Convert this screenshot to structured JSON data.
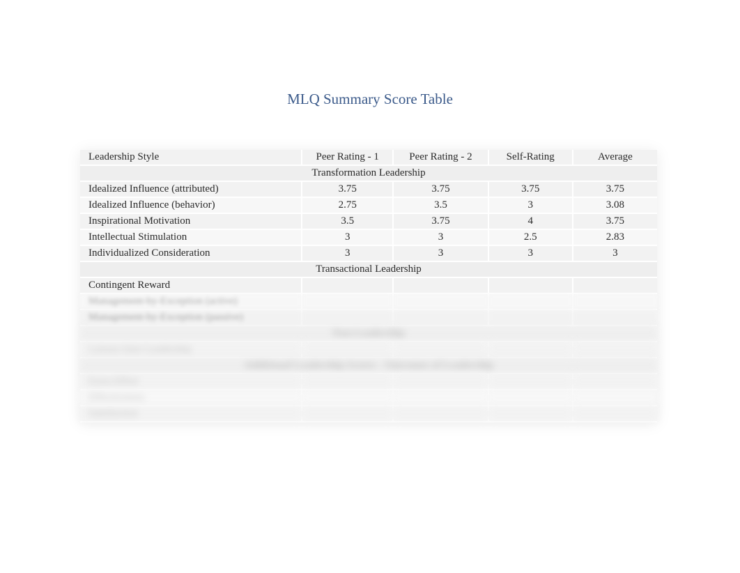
{
  "title": "MLQ Summary Score Table",
  "headers": {
    "style": "Leadership Style",
    "peer1": "Peer Rating - 1",
    "peer2": "Peer Rating - 2",
    "self": "Self-Rating",
    "avg": "Average"
  },
  "sections": {
    "s1": "Transformation Leadership",
    "s2": "Transactional Leadership",
    "s3": "Non-Leadership",
    "s4": "Additional Leadership Scores - Outcomes of Leadership"
  },
  "rows": {
    "r1": {
      "label": "Idealized Influence (attributed)",
      "p1": "3.75",
      "p2": "3.75",
      "self": "3.75",
      "avg": "3.75"
    },
    "r2": {
      "label": "Idealized Influence (behavior)",
      "p1": "2.75",
      "p2": "3.5",
      "self": "3",
      "avg": "3.08"
    },
    "r3": {
      "label": "Inspirational Motivation",
      "p1": "3.5",
      "p2": "3.75",
      "self": "4",
      "avg": "3.75"
    },
    "r4": {
      "label": "Intellectual Stimulation",
      "p1": "3",
      "p2": "3",
      "self": "2.5",
      "avg": "2.83"
    },
    "r5": {
      "label": "Individualized Consideration",
      "p1": "3",
      "p2": "3",
      "self": "3",
      "avg": "3"
    },
    "r6": {
      "label": "Contingent Reward",
      "p1": "",
      "p2": "",
      "self": "",
      "avg": ""
    },
    "r7": {
      "label": "Management-by-Exception (active)",
      "p1": "",
      "p2": "",
      "self": "",
      "avg": ""
    },
    "r8": {
      "label": "Management-by-Exception (passive)",
      "p1": "",
      "p2": "",
      "self": "",
      "avg": ""
    },
    "r9": {
      "label": "Laissez-faire Leadership",
      "p1": "",
      "p2": "",
      "self": "",
      "avg": ""
    },
    "r10": {
      "label": "Extra Effort",
      "p1": "",
      "p2": "",
      "self": "",
      "avg": ""
    },
    "r11": {
      "label": "Effectiveness",
      "p1": "",
      "p2": "",
      "self": "",
      "avg": ""
    },
    "r12": {
      "label": "Satisfaction",
      "p1": "",
      "p2": "",
      "self": "",
      "avg": ""
    }
  }
}
